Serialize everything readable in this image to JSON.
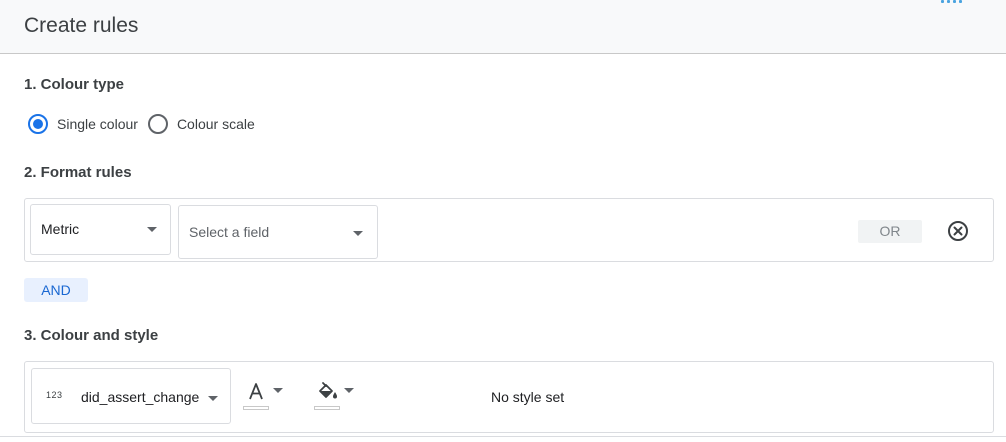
{
  "header": {
    "title": "Create rules"
  },
  "colour_type": {
    "title": "1. Colour type",
    "options": [
      {
        "label": "Single colour",
        "selected": true
      },
      {
        "label": "Colour scale",
        "selected": false
      }
    ]
  },
  "format_rules": {
    "title": "2. Format rules",
    "type_dropdown": {
      "value": "Metric"
    },
    "field_dropdown": {
      "placeholder": "Select a field"
    },
    "or_label": "OR",
    "and_label": "AND"
  },
  "colour_style": {
    "title": "3. Colour and style",
    "field": {
      "type_icon": "123",
      "name": "did_assert_change"
    },
    "tools": [
      {
        "icon": "text-colour-icon"
      },
      {
        "icon": "fill-colour-icon"
      }
    ],
    "status": "No style set"
  },
  "colors": {
    "accent": "#1a73e8",
    "and_bg": "#e8f0fe",
    "and_text": "#1967d2",
    "header_bg": "#f8f9fa"
  }
}
